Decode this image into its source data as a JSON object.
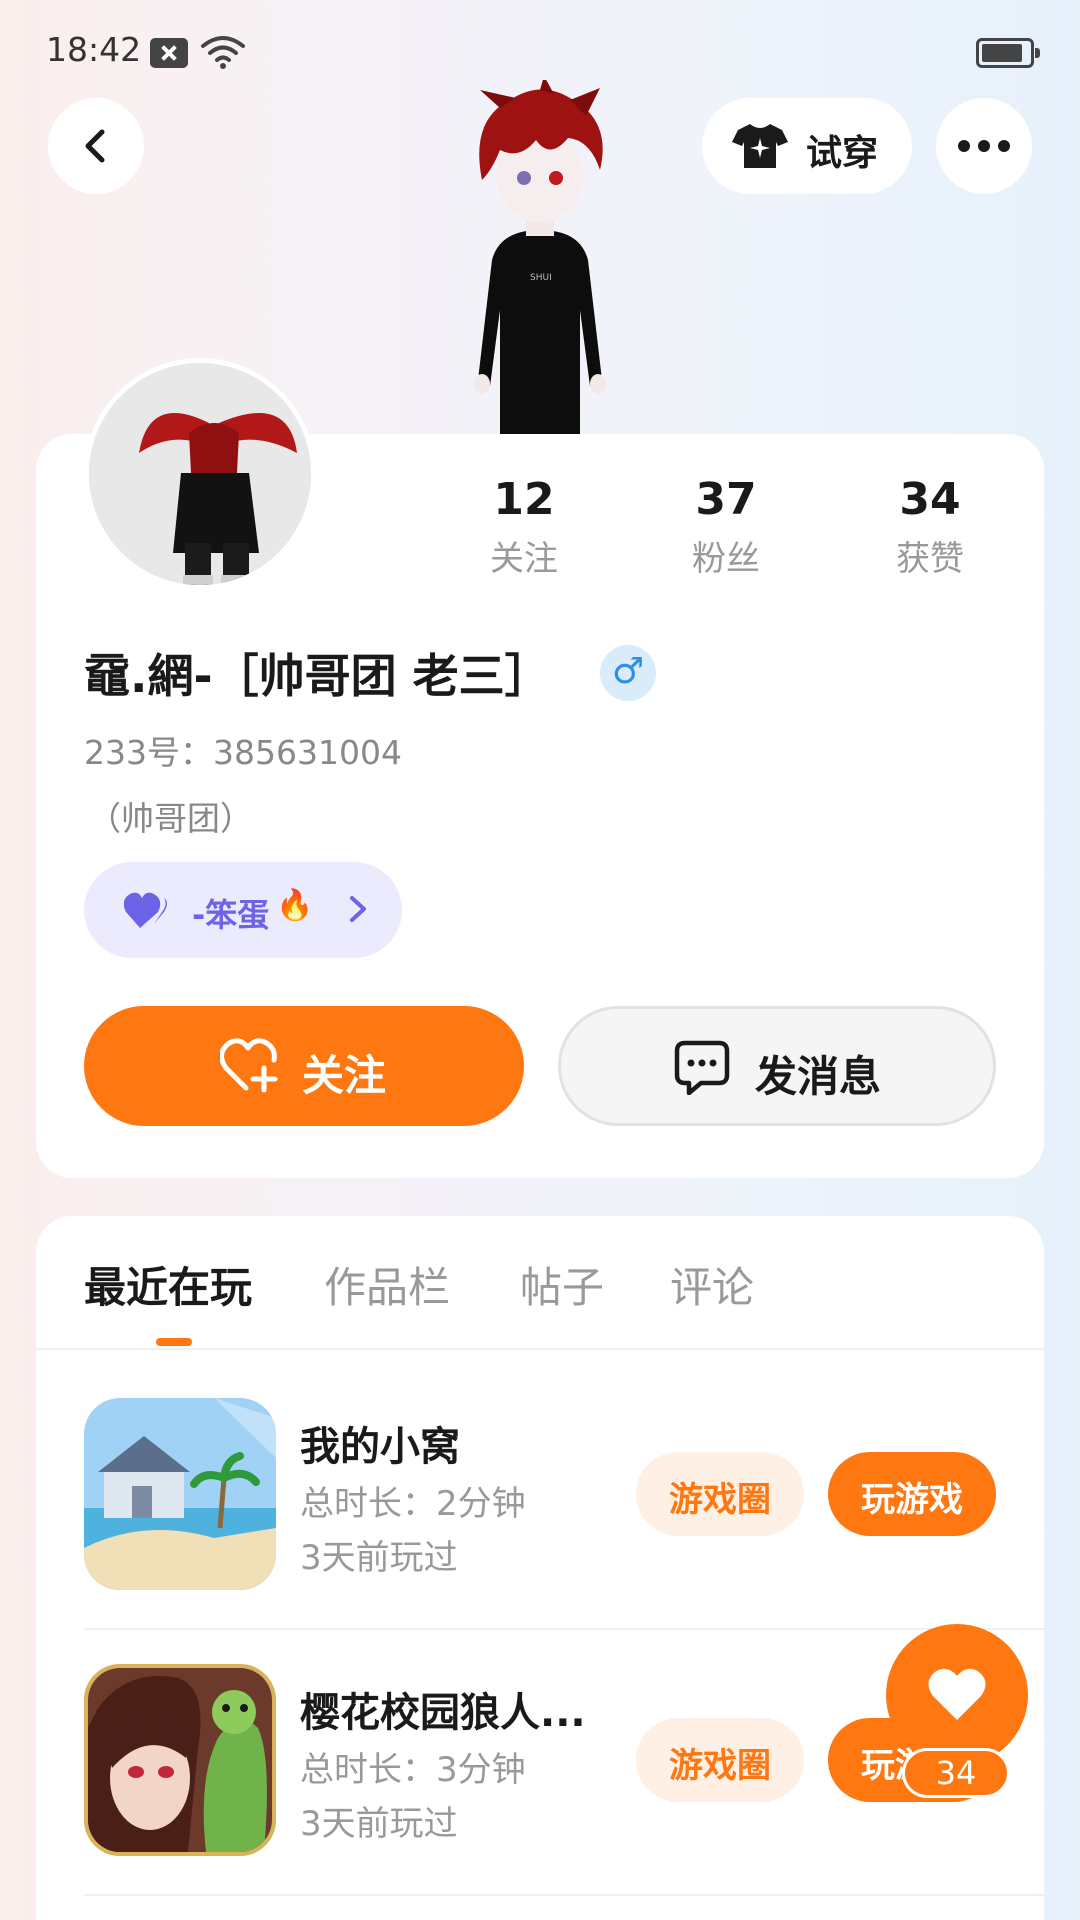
{
  "status_bar": {
    "time": "18:42"
  },
  "header": {
    "tryon_label": "试穿"
  },
  "profile": {
    "stats": [
      {
        "value": "12",
        "label": "关注"
      },
      {
        "value": "37",
        "label": "粉丝"
      },
      {
        "value": "34",
        "label": "获赞"
      }
    ],
    "nickname": "黿.網-［帅哥团  老三］",
    "gender_symbol": "♂",
    "user_id": "233号：385631004",
    "signature": "（帅哥团）",
    "tag_text": "-笨蛋",
    "tag_emoji": "🔥",
    "follow_label": "关注",
    "message_label": "发消息"
  },
  "tabs": [
    "最近在玩",
    "作品栏",
    "帖子",
    "评论"
  ],
  "games": [
    {
      "name": "我的小窝",
      "duration": "总时长：2分钟",
      "last_played": "3天前玩过",
      "circle_label": "游戏圈",
      "play_label": "玩游戏"
    },
    {
      "name": "樱花校园狼人...",
      "duration": "总时长：3分钟",
      "last_played": "3天前玩过",
      "circle_label": "游戏圈",
      "play_label": "玩游戏"
    }
  ],
  "like_fab": {
    "count": "34"
  },
  "colors": {
    "accent": "#ff7711",
    "tag_purple": "#6c63e6",
    "gender_blue": "#2d8ee6"
  }
}
